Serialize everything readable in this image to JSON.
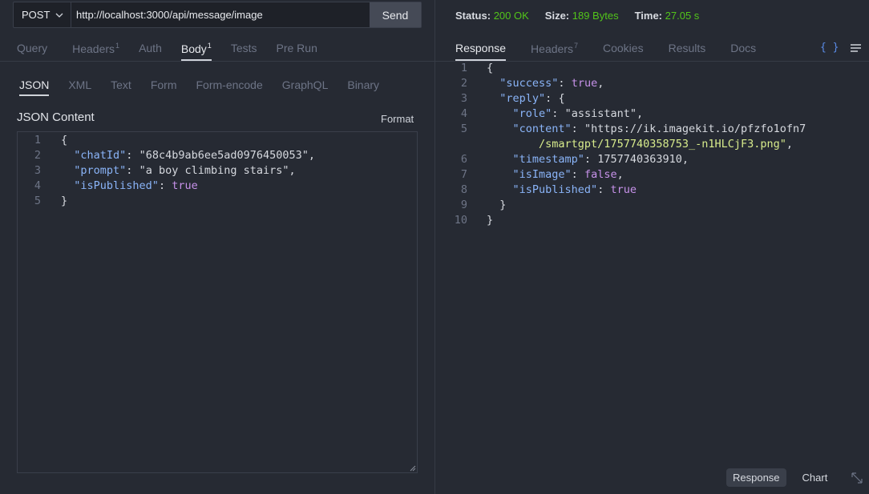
{
  "request": {
    "method": "POST",
    "url": "http://localhost:3000/api/message/image",
    "send_label": "Send"
  },
  "request_tabs": [
    {
      "label": "Query",
      "badge": ""
    },
    {
      "label": "Headers",
      "badge": "1"
    },
    {
      "label": "Auth",
      "badge": ""
    },
    {
      "label": "Body",
      "badge": "1",
      "active": true
    },
    {
      "label": "Tests",
      "badge": ""
    },
    {
      "label": "Pre Run",
      "badge": ""
    }
  ],
  "body_types": [
    "JSON",
    "XML",
    "Text",
    "Form",
    "Form-encode",
    "GraphQL",
    "Binary"
  ],
  "body_type_active": "JSON",
  "content_label": "JSON Content",
  "format_label": "Format",
  "request_body_lines": [
    "{",
    "  \"chatId\": \"68c4b9ab6ee5ad0976450053\",",
    "  \"prompt\": \"a boy climbing stairs\",",
    "  \"isPublished\": true",
    "}"
  ],
  "status": {
    "status_label": "Status:",
    "status_value": "200 OK",
    "size_label": "Size:",
    "size_value": "189 Bytes",
    "time_label": "Time:",
    "time_value": "27.05 s"
  },
  "response_tabs": [
    {
      "label": "Response",
      "badge": "",
      "active": true
    },
    {
      "label": "Headers",
      "badge": "7"
    },
    {
      "label": "Cookies",
      "badge": ""
    },
    {
      "label": "Results",
      "badge": ""
    },
    {
      "label": "Docs",
      "badge": ""
    }
  ],
  "braces_label": "{ }",
  "response_lines": [
    "{",
    "  \"success\": true,",
    "  \"reply\": {",
    "    \"role\": \"assistant\",",
    "    \"content\": \"https://ik.imagekit.io/pfzfo1ofn7",
    "        /smartgpt/1757740358753_-n1HLCjF3.png\",",
    "    \"timestamp\": 1757740363910,",
    "    \"isImage\": false,",
    "    \"isPublished\": true",
    "  }",
    "}"
  ],
  "response_line_numbers": [
    "1",
    "2",
    "3",
    "4",
    "5",
    "",
    "6",
    "7",
    "8",
    "9",
    "10"
  ],
  "bottom": {
    "response_label": "Response",
    "chart_label": "Chart"
  },
  "colors": {
    "background": "#262a33",
    "status_ok": "#52c41a",
    "json_key": "#8ab4f8",
    "json_string": "#d8ec8c",
    "json_literal": "#c792ea"
  },
  "icons": [
    "chevron-down-icon",
    "braces-icon",
    "menu-icon",
    "expand-icon",
    "resize-handle-icon"
  ]
}
